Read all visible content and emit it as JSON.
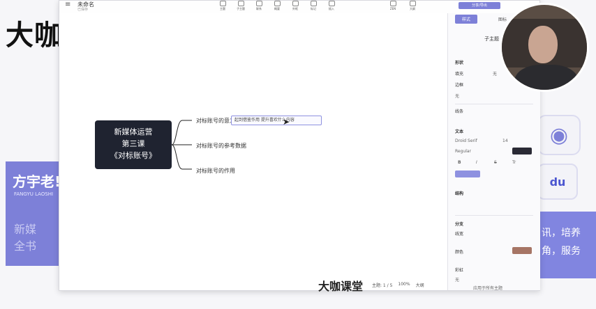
{
  "background": {
    "logo_text": "大咖",
    "teacher_name": "方宇老!",
    "teacher_sub": "FANGYU LAOSHI",
    "side_text": "新媒全书",
    "right_banner": "讯，培养角，服务",
    "baidu_label": "du",
    "accent": "#7d80d8"
  },
  "window": {
    "doc_title": "未命名",
    "doc_sub": "已保存",
    "toolbar": [
      {
        "label": "主题",
        "icon": "theme-icon"
      },
      {
        "label": "子主题",
        "icon": "subtopic-icon"
      },
      {
        "label": "联系",
        "icon": "relation-icon"
      },
      {
        "label": "概要",
        "icon": "summary-icon"
      },
      {
        "label": "外框",
        "icon": "boundary-icon"
      },
      {
        "label": "标记",
        "icon": "marker-icon"
      },
      {
        "label": "插入",
        "icon": "insert-icon"
      }
    ],
    "right_tools": [
      {
        "label": "ZEN",
        "icon": "zen-icon"
      },
      {
        "label": "大纲",
        "icon": "outline-icon"
      }
    ],
    "export_label": "分享/导出"
  },
  "mindmap": {
    "central": [
      "新媒体运营",
      "第三课",
      "《对标账号》"
    ],
    "branches": [
      {
        "label": "对标账号的意义"
      },
      {
        "label": "对标账号的参考数据"
      },
      {
        "label": "对标账号的作用"
      }
    ],
    "subtopic": "起到借鉴作用 提升喜欢什么内容"
  },
  "status": {
    "topic_count": "主题: 1 / 5",
    "zoom": "100%",
    "view": "大纲"
  },
  "panel": {
    "tabs": [
      "样式",
      "图标"
    ],
    "subtopic_label": "子主题",
    "shape_section": "形状",
    "fill_label": "填充",
    "fill_value": "无",
    "border_label": "边框",
    "border_value": "无",
    "line_label": "线条",
    "text_section": "文本",
    "font_name": "Droid Serif",
    "font_size": "14",
    "font_weight": "Regular",
    "bold": "B",
    "italic": "I",
    "strike": "S",
    "case": "Tr",
    "structure_section": "结构",
    "branch_section": "分支",
    "branch_width_label": "线宽",
    "color_label": "颜色",
    "rainbow_label": "彩虹",
    "rainbow_value": "无",
    "apply_label": "应用于所有主题",
    "swatch_dark": "#2a2a35",
    "swatch_brown": "#a67565",
    "swatch_accent": "#8e91e0"
  },
  "bottom_logo": "大咖课堂"
}
